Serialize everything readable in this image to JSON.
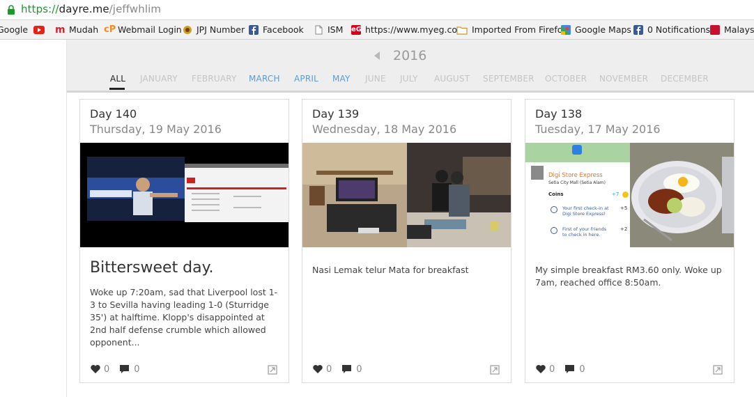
{
  "browser": {
    "url_proto": "https://",
    "url_host": "dayre.me",
    "url_path": "/jeffwhlim",
    "bookmarks": [
      {
        "label": "Google",
        "icon": "google-icon",
        "color": "#4285f4"
      },
      {
        "label": "",
        "icon": "youtube-icon",
        "color": "#e62117"
      },
      {
        "label": "Mudah",
        "icon": "mudah-icon",
        "color": "#d9232d"
      },
      {
        "label": "Webmail Login",
        "icon": "cpanel-icon",
        "color": "#f68b1f"
      },
      {
        "label": "JPJ Number",
        "icon": "jpj-crest-icon",
        "color": "#c9a227"
      },
      {
        "label": "Facebook",
        "icon": "facebook-icon",
        "color": "#3b5998"
      },
      {
        "label": "ISM",
        "icon": "page-icon",
        "color": "#999999"
      },
      {
        "label": "https://www.myeg.co",
        "icon": "myeg-icon",
        "color": "#d6001c"
      },
      {
        "label": "Imported From Firefo",
        "icon": "folder-icon",
        "color": "#e6b449"
      },
      {
        "label": "Google Maps",
        "icon": "google-maps-icon",
        "color": "#34a853"
      },
      {
        "label": "0 Notifications",
        "icon": "facebook-icon",
        "color": "#3b5998"
      },
      {
        "label": "Malaysia",
        "icon": "news-icon",
        "color": "#c8102e"
      }
    ]
  },
  "timeline": {
    "year": "2016",
    "all_label": "ALL",
    "months": [
      {
        "label": "JANUARY",
        "active": false
      },
      {
        "label": "FEBRUARY",
        "active": false
      },
      {
        "label": "MARCH",
        "active": true
      },
      {
        "label": "APRIL",
        "active": true
      },
      {
        "label": "MAY",
        "active": true
      },
      {
        "label": "JUNE",
        "active": false
      },
      {
        "label": "JULY",
        "active": false
      },
      {
        "label": "AUGUST",
        "active": false
      },
      {
        "label": "SEPTEMBER",
        "active": false
      },
      {
        "label": "OCTOBER",
        "active": false
      },
      {
        "label": "NOVEMBER",
        "active": false
      },
      {
        "label": "DECEMBER",
        "active": false
      }
    ]
  },
  "cards": [
    {
      "day": "Day 140",
      "date": "Thursday, 19 May 2016",
      "title": "Bittersweet day.",
      "body": "Woke up 7:20am, sad that Liverpool lost 1-3 to Sevilla having leading 1-0 (Sturridge 35') at halftime. Klopp's disappointed at 2nd half defense crumble which allowed opponent...",
      "likes": "0",
      "comments": "0",
      "photo_desc": "badminton-tv-and-scoreboard"
    },
    {
      "day": "Day 139",
      "date": "Wednesday, 18 May 2016",
      "title": "",
      "body": "Nasi Lemak telur Mata for breakfast",
      "likes": "0",
      "comments": "0",
      "photo_desc": "living-room-tv-and-friends"
    },
    {
      "day": "Day 138",
      "date": "Tuesday, 17 May 2016",
      "title": "",
      "body": "My simple breakfast RM3.60 only. Woke up 7am, reached office 8:50am.",
      "likes": "0",
      "comments": "0",
      "checkin": {
        "place": "Digi Store Express",
        "address": "Setia City Mall (Setia Alam)",
        "coins_label": "Coins",
        "coins_value": "+7",
        "reward1_text": "Your first check-in at Digi Store Express!",
        "reward1_value": "+5",
        "reward2_text": "First of your friends to check in here.",
        "reward2_value": "+2"
      }
    }
  ]
}
